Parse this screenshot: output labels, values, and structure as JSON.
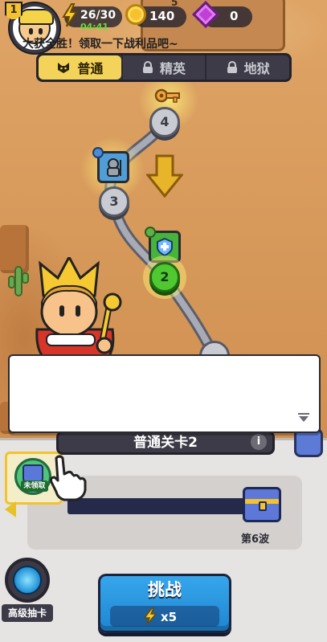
{
  "hud": {
    "level": "1",
    "energy": "26/30",
    "energy_timer": "04:41",
    "coins": "140",
    "gems": "0",
    "sign_number": "5"
  },
  "tabs": [
    {
      "label": "普通",
      "icon": "cat-face-icon",
      "active": true
    },
    {
      "label": "精英",
      "icon": "lock-icon",
      "active": false
    },
    {
      "label": "地狱",
      "icon": "lock-icon",
      "active": false
    }
  ],
  "map": {
    "nodes": [
      {
        "label": "4",
        "state": "locked"
      },
      {
        "label": "3",
        "state": "locked"
      },
      {
        "label": "2",
        "state": "current"
      }
    ],
    "stage_icons": [
      "key-icon",
      "knight-icon",
      "shield-icon"
    ]
  },
  "dialog": {
    "text": "大获全胜！领取一下战利品吧~"
  },
  "stage": {
    "title": "普通关卡2",
    "info": "i"
  },
  "reward": {
    "status": "未领取",
    "progress": 0.0,
    "wave_label": "第6波"
  },
  "gacha": {
    "label": "高级抽卡"
  },
  "challenge": {
    "label": "挑战",
    "cost": "x5"
  },
  "colors": {
    "accent": "#f4d35b",
    "current_node": "#4fc832",
    "challenge_button": "#2a98e0",
    "dark_panel": "#3c3b47"
  }
}
